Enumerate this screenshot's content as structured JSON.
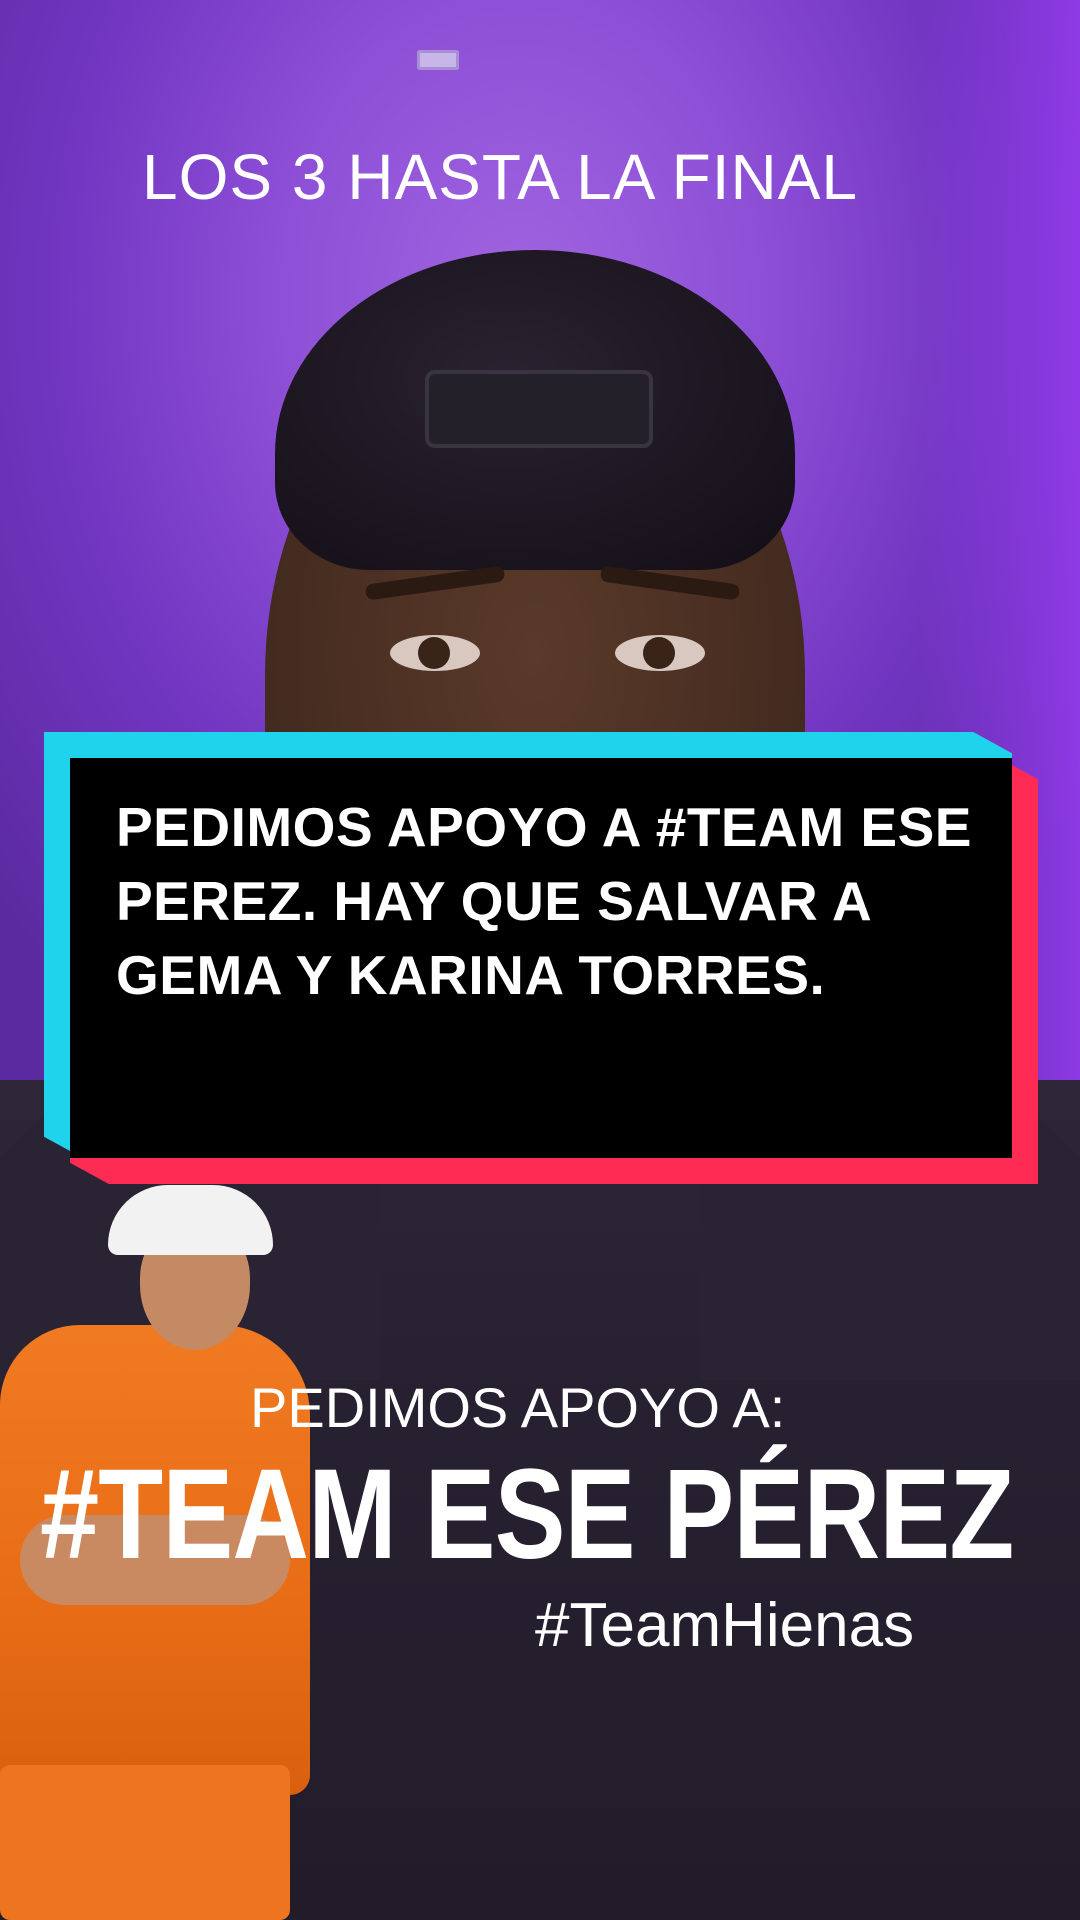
{
  "video": {
    "top_caption": "LOS 3 HASTA LA FINAL",
    "card_message": "PEDIMOS APOYO A #TEAM ESE PEREZ. HAY QUE SALVAR A GEMA Y KARINA TORRES.",
    "promo": {
      "line_small": "PEDIMOS APOYO A:",
      "line_big": "#TEAM ESE PÉREZ",
      "hashtag": "#TeamHienas"
    }
  },
  "colors": {
    "background_purple": "#8d4fd6",
    "card_cyan": "#20d3ec",
    "card_red": "#fe2c55",
    "card_fill": "#000000",
    "text": "#ffffff",
    "orange_outfit": "#f07a22"
  },
  "icons": {
    "wall_outlet": "wall-outlet-icon"
  }
}
